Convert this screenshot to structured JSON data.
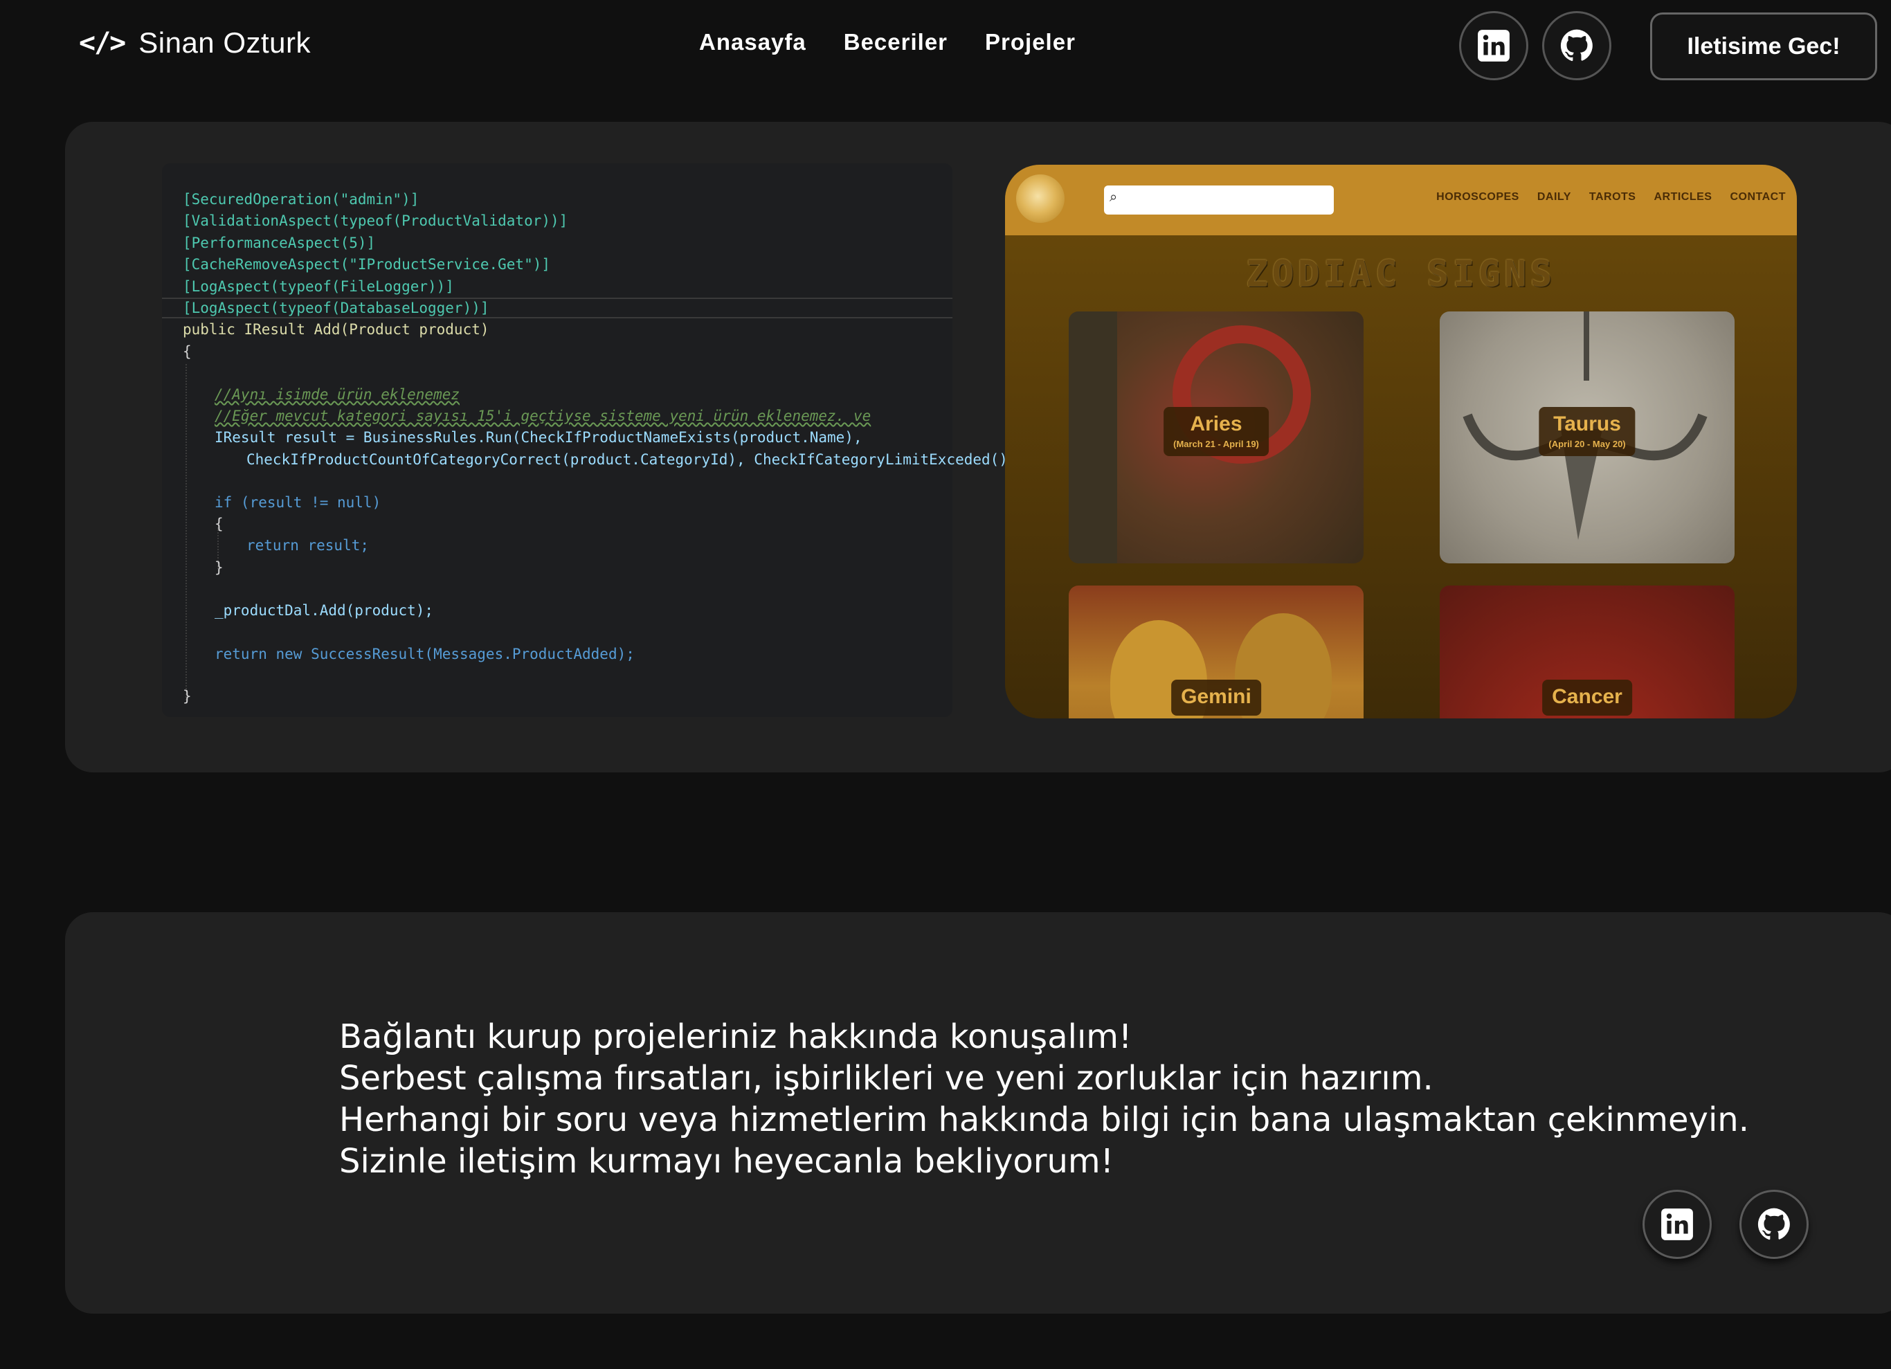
{
  "navbar": {
    "brand_glyph": "</>",
    "brand_name": "Sinan Ozturk",
    "links": [
      "Anasayfa",
      "Beceriler",
      "Projeler"
    ],
    "contact_button": "Iletisime Gec!"
  },
  "project": {
    "code": {
      "attributes": [
        "[SecuredOperation(\"admin\")]",
        "[ValidationAspect(typeof(ProductValidator))]",
        "[PerformanceAspect(5)]",
        "[CacheRemoveAspect(\"IProductService.Get\")]",
        "[LogAspect(typeof(FileLogger))]",
        "[LogAspect(typeof(DatabaseLogger))]"
      ],
      "signature": "public IResult Add(Product product)",
      "open_brace": "{",
      "comment1": "//Aynı isimde ürün eklenemez",
      "comment2": "//Eğer mevcut kategori sayısı 15'i geçtiyse sisteme yeni ürün eklenemez. ve",
      "result_line": "IResult result = BusinessRules.Run(CheckIfProductNameExists(product.Name),",
      "result_line2": "CheckIfProductCountOfCategoryCorrect(product.CategoryId), CheckIfCategoryLimitExceded());",
      "if_line": "if (result != null)",
      "if_open": "{",
      "return_result": "return result;",
      "if_close": "}",
      "dal_line": "_productDal.Add(product);",
      "return_success": "return new SuccessResult(Messages.ProductAdded);",
      "close_brace": "}"
    },
    "zodiac": {
      "nav": [
        "HOROSCOPES",
        "DAILY",
        "TAROTS",
        "ARTICLES",
        "CONTACT"
      ],
      "title": "ZODIAC SIGNS",
      "cards": [
        {
          "name": "Aries",
          "date": "(March 21 - April 19)"
        },
        {
          "name": "Taurus",
          "date": "(April 20 - May 20)"
        },
        {
          "name": "Gemini",
          "date": ""
        },
        {
          "name": "Cancer",
          "date": ""
        }
      ]
    }
  },
  "contact": {
    "lines": [
      "Bağlantı kurup projeleriniz hakkında konuşalım!",
      "Serbest çalışma fırsatları, işbirlikleri ve yeni zorluklar için hazırım.",
      "Herhangi bir soru veya hizmetlerim hakkında bilgi için bana ulaşmaktan çekinmeyin.",
      "Sizinle iletişim kurmayı heyecanla bekliyorum!"
    ]
  },
  "icons": {
    "linkedin": "linkedin-icon",
    "github": "github-icon"
  }
}
